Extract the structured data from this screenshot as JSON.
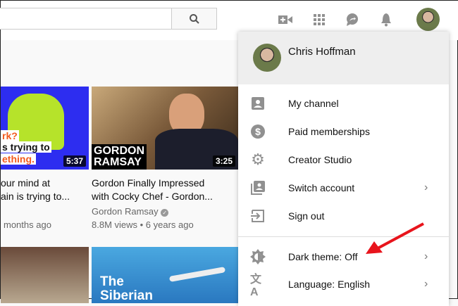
{
  "header": {
    "search_placeholder": "",
    "icons": [
      "create-video-icon",
      "apps-icon",
      "messages-icon",
      "notifications-icon",
      "account-avatar"
    ]
  },
  "videos": [
    {
      "title_line1": "our mind at",
      "title_line2": "ain is trying to...",
      "meta": "months ago",
      "duration": "5:37",
      "thumb_text": [
        "rk?",
        "s trying to",
        "ething."
      ]
    },
    {
      "title_line1": "Gordon Finally Impressed",
      "title_line2": "with Cocky Chef - Gordon...",
      "channel": "Gordon Ramsay",
      "meta": "8.8M views • 6 years ago",
      "duration": "3:25",
      "thumb_text": [
        "GORDON",
        "RAMSAY"
      ]
    },
    {
      "thumb_text": [
        "The",
        "Siberian"
      ]
    }
  ],
  "menu": {
    "user_name": "Chris Hoffman",
    "items": [
      {
        "label": "My channel",
        "icon": "person-icon"
      },
      {
        "label": "Paid memberships",
        "icon": "dollar-icon"
      },
      {
        "label": "Creator Studio",
        "icon": "gear-icon"
      },
      {
        "label": "Switch account",
        "icon": "switch-account-icon"
      },
      {
        "label": "Sign out",
        "icon": "sign-out-icon"
      },
      {
        "label": "Dark theme: Off",
        "icon": "dark-theme-icon"
      },
      {
        "label": "Language: English",
        "icon": "translate-icon"
      }
    ]
  }
}
